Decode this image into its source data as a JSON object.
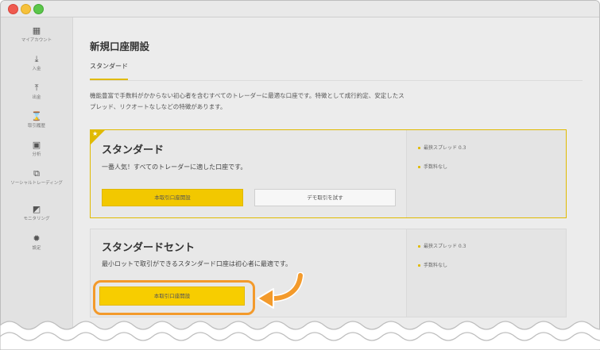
{
  "sidebar": {
    "items": [
      {
        "icon": "qr-icon",
        "glyph": "▦",
        "label": "マイアカウント"
      },
      {
        "icon": "download-icon",
        "glyph": "⤓",
        "label": "入金"
      },
      {
        "icon": "upload-icon",
        "glyph": "⤒",
        "label": "出金"
      },
      {
        "icon": "hourglass-icon",
        "glyph": "⌛",
        "label": "取引履歴"
      },
      {
        "icon": "chart-icon",
        "glyph": "▣",
        "label": "分析"
      },
      {
        "icon": "copy-icon",
        "glyph": "⧉",
        "label": "ソーシャルトレーディング"
      },
      {
        "icon": "monitor-icon",
        "glyph": "◩",
        "label": "モニタリング"
      },
      {
        "icon": "gear-icon",
        "glyph": "✹",
        "label": "設定"
      }
    ]
  },
  "main": {
    "title": "新規口座開設",
    "tab": "スタンダード",
    "description": "機能豊富で手数料がかからない初心者を含むすべてのトレーダーに最適な口座です。特徴として成行約定、安定したスプレッド、リクオートなしなどの特徴があります。",
    "cards": [
      {
        "title": "スタンダード",
        "subtitle": "一番人気！すべてのトレーダーに適した口座です。",
        "primary_button": "本取引口座開設",
        "secondary_button": "デモ取引を試す",
        "features": [
          "最狭スプレッド 0.3",
          "手数料なし"
        ]
      },
      {
        "title": "スタンダードセント",
        "subtitle": "最小ロットで取引ができるスタンダード口座は初心者に最適です。",
        "primary_button": "本取引口座開設",
        "features": [
          "最狭スプレッド 0.3",
          "手数料なし"
        ]
      }
    ]
  },
  "colors": {
    "accent": "#f2c800",
    "highlight": "#f39a2b"
  }
}
